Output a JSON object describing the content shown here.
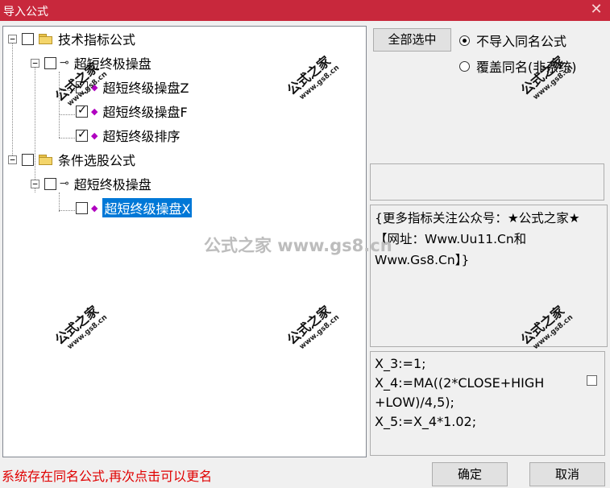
{
  "window": {
    "title": "导入公式",
    "close_glyph": "✕"
  },
  "tree": {
    "groups": [
      {
        "label": "技术指标公式",
        "checked": false,
        "item": {
          "label": "超短终极操盘",
          "children": [
            {
              "label": "超短终级操盘Z",
              "checked": true
            },
            {
              "label": "超短终级操盘F",
              "checked": true
            },
            {
              "label": "超短终级排序",
              "checked": true
            }
          ]
        }
      },
      {
        "label": "条件选股公式",
        "checked": false,
        "item": {
          "label": "超短终极操盘",
          "children": [
            {
              "label": "超短终级操盘X",
              "checked": false,
              "selected": true
            }
          ]
        }
      }
    ],
    "expander_glyph": "−"
  },
  "options": {
    "select_all_label": "全部选中",
    "radio_no_import_label": "不导入同名公式",
    "radio_overwrite_label": "覆盖同名(非系统)",
    "selected": "no_import"
  },
  "description": "{更多指标关注公众号：★公式之家★ 【网址：Www.Uu11.Cn和Www.Gs8.Cn】}",
  "code_lines": [
    "X_3:=1;",
    "X_4:=MA((2*CLOSE+HIGH",
    "+LOW)/4,5);",
    "X_5:=X_4*1.02;"
  ],
  "status": "系统存在同名公式,再次点击可以更名",
  "buttons": {
    "ok": "确定",
    "cancel": "取消"
  },
  "watermark": {
    "brand": "公式之家",
    "url": "www.gs8.cn",
    "center": "公式之家 www.gs8.cn"
  },
  "colors": {
    "titlebar": "#c8283c",
    "selection": "#0078d7",
    "status_text": "#e00000"
  }
}
